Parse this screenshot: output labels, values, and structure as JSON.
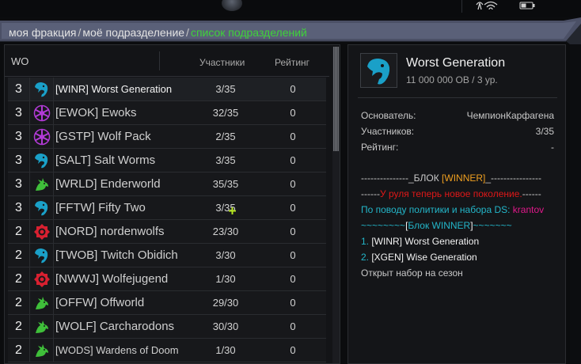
{
  "breadcrumb": {
    "item1": "моя фракция",
    "sep": "/",
    "item2": "моё подразделение",
    "current": "список подразделений"
  },
  "list": {
    "header_col1": "WO",
    "header_members": "Участники",
    "header_rating": "Рейтинг",
    "rows": [
      {
        "level": "3",
        "emblem": "eagle-icon",
        "name": "[WINR] Worst Generation",
        "members": "3/35",
        "rating": "0"
      },
      {
        "level": "3",
        "emblem": "star-icon",
        "name": "[EWOK] Ewoks",
        "members": "32/35",
        "rating": "0"
      },
      {
        "level": "3",
        "emblem": "star-icon",
        "name": "[GSTP] Wolf Pack",
        "members": "2/35",
        "rating": "0"
      },
      {
        "level": "3",
        "emblem": "eagle-icon",
        "name": "[SALT] Salt Worms",
        "members": "3/35",
        "rating": "0"
      },
      {
        "level": "3",
        "emblem": "dragon-icon",
        "name": "[WRLD] Enderworld",
        "members": "35/35",
        "rating": "0"
      },
      {
        "level": "3",
        "emblem": "eagle-icon",
        "name": "[FFTW] Fifty Two",
        "members": "3/35",
        "rating": "0"
      },
      {
        "level": "2",
        "emblem": "gear-icon",
        "name": "[NORD] nordenwolfs",
        "members": "23/30",
        "rating": "0"
      },
      {
        "level": "2",
        "emblem": "eagle-icon",
        "name": "[TWOB] Twitch Obidich",
        "members": "3/30",
        "rating": "0"
      },
      {
        "level": "2",
        "emblem": "gear-icon",
        "name": "[NWWJ] Wolfejugend",
        "members": "1/30",
        "rating": "0"
      },
      {
        "level": "2",
        "emblem": "dragon-icon",
        "name": "[OFFW] Offworld",
        "members": "29/30",
        "rating": "0"
      },
      {
        "level": "2",
        "emblem": "dragon-icon",
        "name": "[WOLF] Carcharodons",
        "members": "30/30",
        "rating": "0"
      },
      {
        "level": "2",
        "emblem": "dragon-icon",
        "name": "[WODS] Wardens of Doom",
        "members": "1/30",
        "rating": "0"
      }
    ]
  },
  "detail": {
    "emblem": "eagle-icon",
    "title": "Worst Generation",
    "subtitle": "11 000 000 ОВ / 3 ур.",
    "founder_label": "Основатель:",
    "founder_value": "ЧемпионКарфагена",
    "members_label": "Участников:",
    "members_value": "3/35",
    "rating_label": "Рейтинг:",
    "rating_value": "-",
    "desc": {
      "l1a": "---------------_БЛОК ",
      "l1b": "[WINNER]",
      "l1c": "_----------------",
      "l2a": "------",
      "l2b": "У руля теперь новое поколение.",
      "l2c": "------",
      "l3a": "По поводу политики и набора DS: ",
      "l3b": "krantov",
      "l4a": "~~~~~~~~",
      "l4b": "[",
      "l4c": "Блок WINNER",
      "l4d": "]",
      "l4e": "~~~~~~~",
      "l5a": "1. ",
      "l5b": "[WINR] Worst Generation",
      "l6a": "2. ",
      "l6b": "[XGEN] Wise Generation",
      "l7": "Открыт набор на сезон"
    }
  },
  "colors": {
    "accent_green": "#3fd23a",
    "eagle_blue": "#1aa0c8",
    "star_purple": "#b23ad6",
    "dragon_green": "#3fbf3a",
    "gear_red": "#d82030"
  }
}
